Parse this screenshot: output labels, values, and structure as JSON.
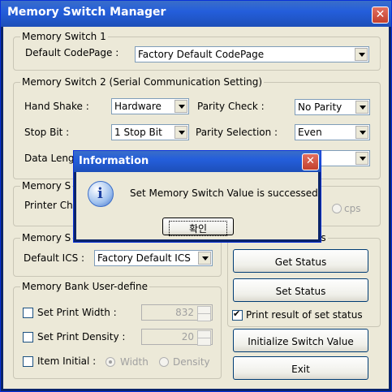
{
  "window": {
    "title": "Memory Switch Manager",
    "close": "✕"
  },
  "ms1": {
    "title": "Memory Switch 1",
    "codepage_label": "Default CodePage :",
    "codepage_value": "Factory Default CodePage"
  },
  "ms2": {
    "title": "Memory Switch 2 (Serial Communication Setting)",
    "handshake_label": "Hand Shake :",
    "handshake_value": "Hardware",
    "parity_check_label": "Parity Check :",
    "parity_check_value": "No Parity",
    "stop_bit_label": "Stop Bit :",
    "stop_bit_value": "1 Stop Bit",
    "parity_sel_label": "Parity Selection :",
    "parity_sel_value": "Even",
    "data_len_label": "Data Leng"
  },
  "ms3": {
    "title": "Memory S",
    "printer_label": "Printer Ch",
    "cps": "cps"
  },
  "ms4": {
    "title": "Memory S",
    "ics_label": "Default ICS :",
    "ics_value": "Factory Default ICS"
  },
  "status": {
    "title_tail": "tatus",
    "get_status": "Get Status",
    "set_status": "Set Status",
    "print_result": "Print result of set status"
  },
  "bank": {
    "title": "Memory Bank User-define",
    "print_width_label": "Set Print Width :",
    "print_width_value": "832",
    "print_density_label": "Set Print Density :",
    "print_density_value": "20",
    "item_initial_label": "Item Initial :",
    "width_label": "Width",
    "density_label": "Density"
  },
  "buttons": {
    "initialize": "Initialize Switch Value",
    "exit": "Exit"
  },
  "dialog": {
    "title": "Information",
    "close": "✕",
    "message": "Set Memory Switch Value is successed",
    "ok": "확인"
  }
}
